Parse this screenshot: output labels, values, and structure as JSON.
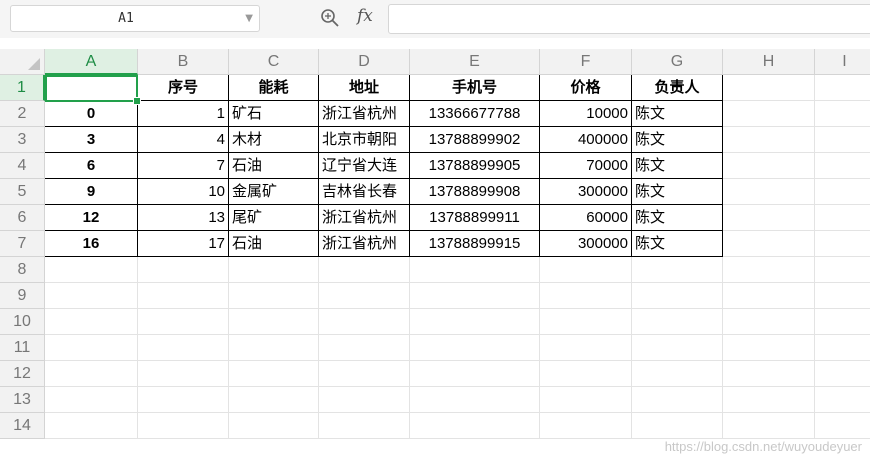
{
  "formula_bar": {
    "name_box": "A1",
    "fx_label": "fx",
    "formula_value": ""
  },
  "columns": [
    "A",
    "B",
    "C",
    "D",
    "E",
    "F",
    "G",
    "H",
    "I"
  ],
  "rows": [
    "1",
    "2",
    "3",
    "4",
    "5",
    "6",
    "7",
    "8",
    "9",
    "10",
    "11",
    "12",
    "13",
    "14"
  ],
  "selected_cell": "A1",
  "header_row": [
    "",
    "序号",
    "能耗",
    "地址",
    "手机号",
    "价格",
    "负责人"
  ],
  "data_rows": [
    {
      "A": "0",
      "B": "1",
      "C": "矿石",
      "D": "浙江省杭州",
      "E": "13366677788",
      "F": "10000",
      "G": "陈文"
    },
    {
      "A": "3",
      "B": "4",
      "C": "木材",
      "D": "北京市朝阳",
      "E": "13788899902",
      "F": "400000",
      "G": "陈文"
    },
    {
      "A": "6",
      "B": "7",
      "C": "石油",
      "D": "辽宁省大连",
      "E": "13788899905",
      "F": "70000",
      "G": "陈文"
    },
    {
      "A": "9",
      "B": "10",
      "C": "金属矿",
      "D": "吉林省长春",
      "E": "13788899908",
      "F": "300000",
      "G": "陈文"
    },
    {
      "A": "12",
      "B": "13",
      "C": "尾矿",
      "D": "浙江省杭州",
      "E": "13788899911",
      "F": "60000",
      "G": "陈文"
    },
    {
      "A": "16",
      "B": "17",
      "C": "石油",
      "D": "浙江省杭州",
      "E": "13788899915",
      "F": "300000",
      "G": "陈文"
    }
  ],
  "watermark": "https://blog.csdn.net/wuyoudeyuer",
  "colors": {
    "accent": "#22a04b",
    "header_bg": "#f2f2f2"
  }
}
